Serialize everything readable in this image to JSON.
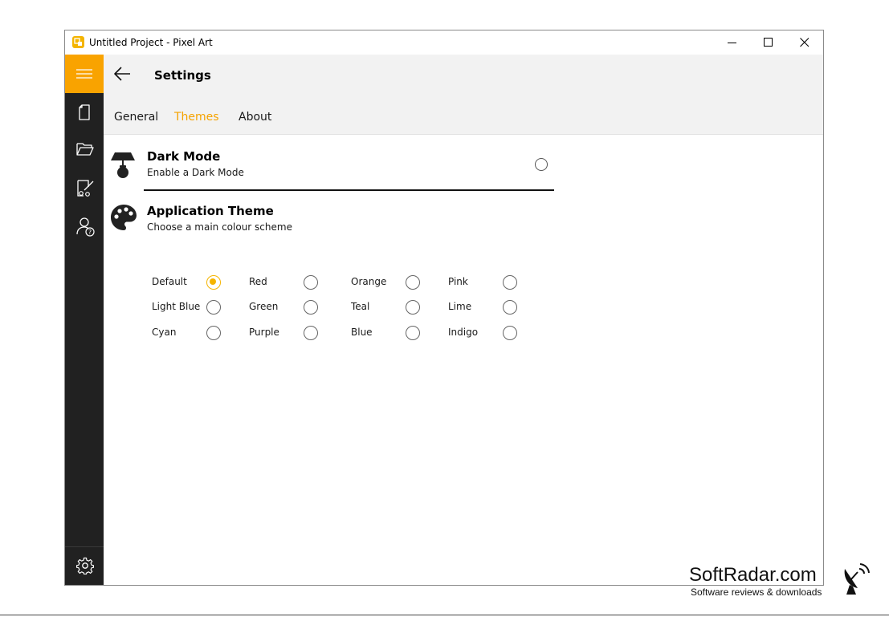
{
  "window": {
    "title": "Untitled Project - Pixel Art",
    "accent_color": "#f9a300",
    "sidebar_color": "#212121"
  },
  "sidebar": {
    "items": [
      {
        "name": "menu",
        "icon": "hamburger-icon"
      },
      {
        "name": "new",
        "icon": "document-icon"
      },
      {
        "name": "open",
        "icon": "folder-icon"
      },
      {
        "name": "export",
        "icon": "export-icon"
      },
      {
        "name": "about",
        "icon": "user-help-icon"
      },
      {
        "name": "settings",
        "icon": "gear-icon"
      }
    ]
  },
  "header": {
    "title": "Settings",
    "tabs": [
      {
        "label": "General",
        "active": false
      },
      {
        "label": "Themes",
        "active": true
      },
      {
        "label": "About",
        "active": false
      }
    ]
  },
  "dark_mode": {
    "title": "Dark Mode",
    "description": "Enable a Dark Mode",
    "icon": "lamp-icon",
    "enabled": false
  },
  "app_theme": {
    "title": "Application Theme",
    "description": "Choose a main colour scheme",
    "icon": "palette-icon",
    "selected": "Default",
    "options": [
      "Default",
      "Red",
      "Orange",
      "Pink",
      "Light Blue",
      "Green",
      "Teal",
      "Lime",
      "Cyan",
      "Purple",
      "Blue",
      "Indigo"
    ]
  },
  "watermark": {
    "title": "SoftRadar.com",
    "subtitle": "Software reviews & downloads"
  }
}
